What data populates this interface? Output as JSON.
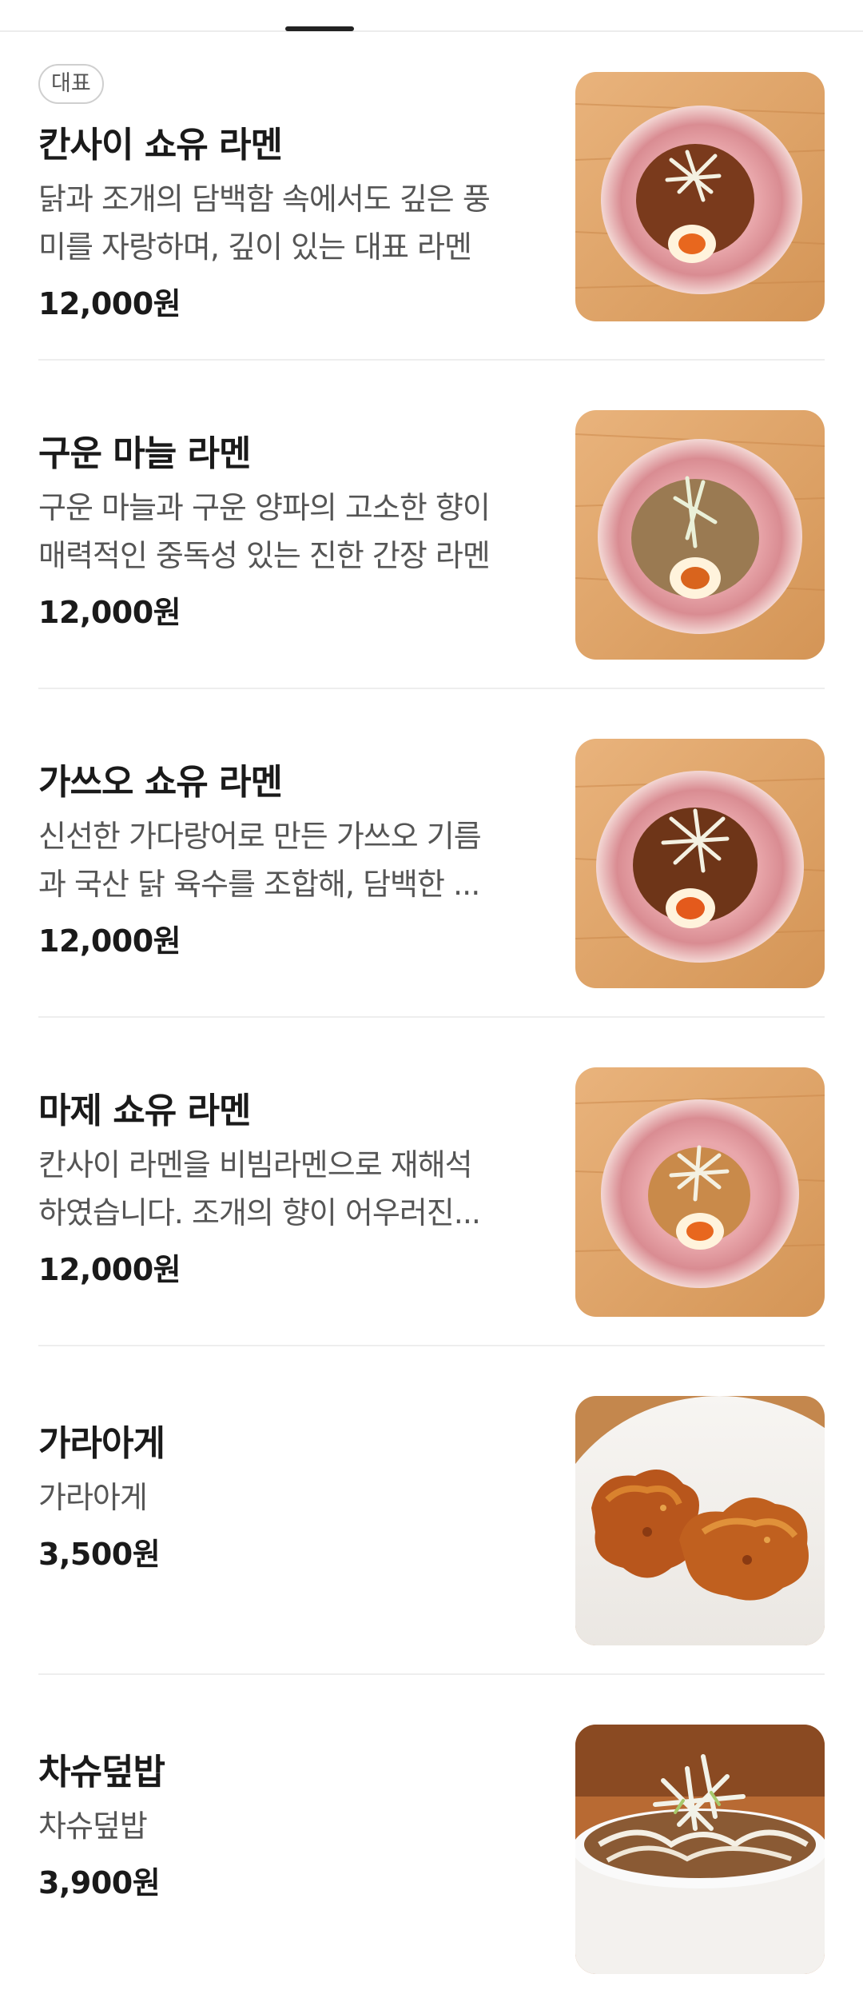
{
  "menu": {
    "items": [
      {
        "badge": "대표",
        "title": "칸사이 쇼유 라멘",
        "desc_lines": [
          "닭과 조개의 담백함 속에서도 깊은 풍",
          "미를 자랑하며, 깊이 있는 대표 라멘"
        ],
        "price": "12,000원",
        "image_icon": "ramen-bowl-image",
        "broth_color": "#7a3a1c"
      },
      {
        "title": "구운 마늘 라멘",
        "desc_lines": [
          "구운 마늘과 구운 양파의 고소한 향이",
          "매력적인 중독성 있는 진한 간장 라멘"
        ],
        "price": "12,000원",
        "image_icon": "ramen-bowl-image",
        "broth_color": "#9a7a52"
      },
      {
        "title": "가쓰오 쇼유 라멘",
        "desc_lines": [
          "신선한 가다랑어로 만든 가쓰오 기름",
          "과 국산 닭 육수를 조합해, 담백한 ..."
        ],
        "price": "12,000원",
        "image_icon": "ramen-bowl-image",
        "broth_color": "#6e3518"
      },
      {
        "title": "마제 쇼유 라멘",
        "desc_lines": [
          "칸사이 라멘을 비빔라멘으로 재해석",
          "하였습니다. 조개의 향이 어우러진..."
        ],
        "price": "12,000원",
        "image_icon": "mazeman-bowl-image",
        "broth_color": "#c98a4a"
      },
      {
        "title": "가라아게",
        "desc_lines": [
          "가라아게"
        ],
        "price": "3,500원",
        "image_icon": "fried-chicken-image"
      },
      {
        "title": "차슈덮밥",
        "desc_lines": [
          "차슈덮밥"
        ],
        "price": "3,900원",
        "image_icon": "chashu-rice-bowl-image"
      }
    ]
  }
}
